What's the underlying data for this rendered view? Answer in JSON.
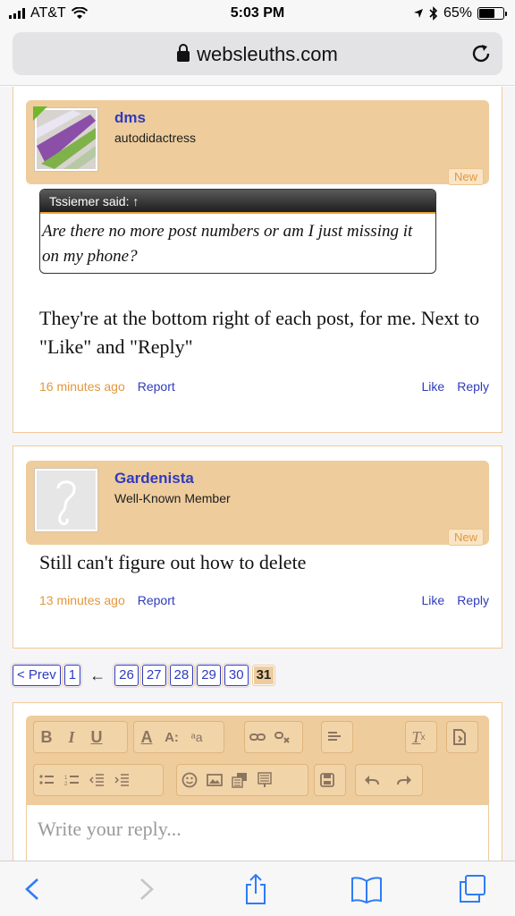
{
  "status": {
    "carrier": "AT&T",
    "time": "5:03 PM",
    "battery": "65%",
    "battery_level": 0.65
  },
  "browser": {
    "url": "websleuths.com"
  },
  "posts": [
    {
      "username": "dms",
      "user_title": "autodidactress",
      "new_badge": "New",
      "quote_author": "Tssiemer said: ↑",
      "quote_text": "Are there no more post numbers or am I just missing it on my phone?",
      "message": "They're at the bottom right of each post, for me. Next to \"Like\" and \"Reply\"",
      "time": "16 minutes ago",
      "report": "Report",
      "like": "Like",
      "reply": "Reply"
    },
    {
      "username": "Gardenista",
      "user_title": "Well-Known Member",
      "new_badge": "New",
      "message": "Still can't figure out how to delete",
      "time": "13 minutes ago",
      "report": "Report",
      "like": "Like",
      "reply": "Reply"
    }
  ],
  "pagination": {
    "prev": "< Prev",
    "first": "1",
    "ellipsis_arrow": "←",
    "pages": [
      "26",
      "27",
      "28",
      "29",
      "30"
    ],
    "current": "31"
  },
  "editor": {
    "placeholder": "Write your reply..."
  }
}
